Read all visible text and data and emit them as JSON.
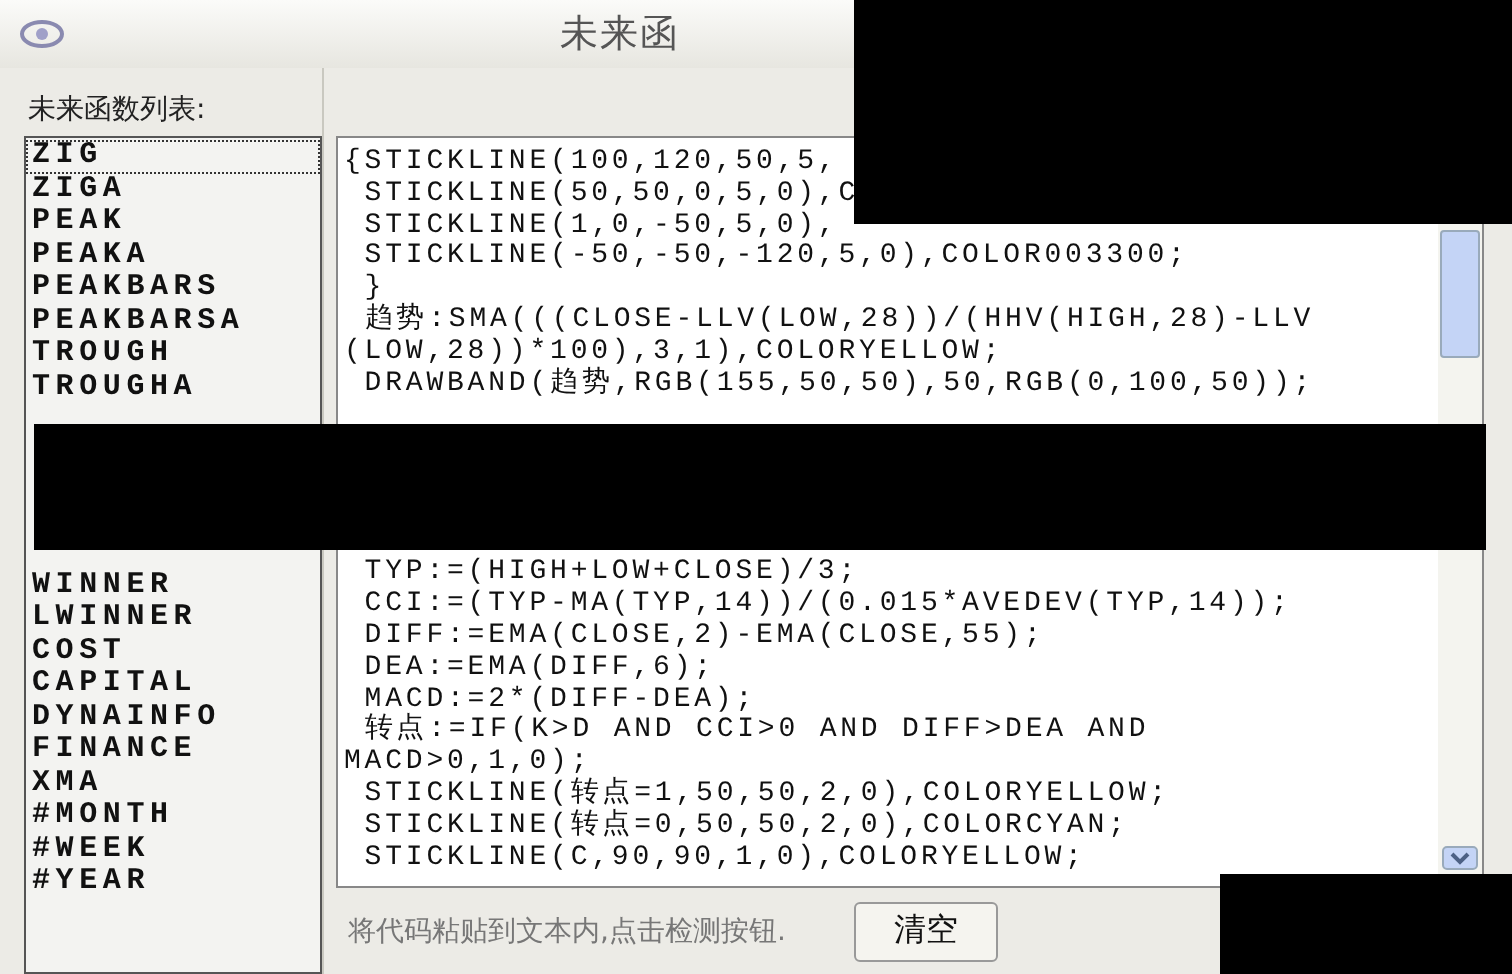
{
  "window": {
    "title": "未来函"
  },
  "function_list": {
    "label": "未来函数列表:",
    "items": [
      {
        "name": "ZIG",
        "selected": true
      },
      {
        "name": "ZIGA",
        "selected": false
      },
      {
        "name": "PEAK",
        "selected": false
      },
      {
        "name": "PEAKA",
        "selected": false
      },
      {
        "name": "PEAKBARS",
        "selected": false
      },
      {
        "name": "PEAKBARSA",
        "selected": false
      },
      {
        "name": "TROUGH",
        "selected": false
      },
      {
        "name": "TROUGHA",
        "selected": false
      }
    ],
    "items_below": [
      {
        "name": "WINNER",
        "selected": false
      },
      {
        "name": "LWINNER",
        "selected": false
      },
      {
        "name": "COST",
        "selected": false
      },
      {
        "name": "CAPITAL",
        "selected": false
      },
      {
        "name": "DYNAINFO",
        "selected": false
      },
      {
        "name": "FINANCE",
        "selected": false
      },
      {
        "name": "XMA",
        "selected": false
      },
      {
        "name": "#MONTH",
        "selected": false
      },
      {
        "name": "#WEEK",
        "selected": false
      },
      {
        "name": "#YEAR",
        "selected": false
      }
    ]
  },
  "code": {
    "lines": [
      "{STICKLINE(100,120,50,5,",
      " STICKLINE(50,50,0,5,0),C",
      " STICKLINE(1,0,-50,5,0),",
      " STICKLINE(-50,-50,-120,5,0),COLOR003300;",
      " }",
      " 趋势:SMA(((CLOSE-LLV(LOW,28))/(HHV(HIGH,28)-LLV",
      "(LOW,28))*100),3,1),COLORYELLOW;",
      " DRAWBAND(趋势,RGB(155,50,50),50,RGB(0,100,50));"
    ],
    "lines_below": [
      " TYP:=(HIGH+LOW+CLOSE)/3;",
      " CCI:=(TYP-MA(TYP,14))/(0.015*AVEDEV(TYP,14));",
      " DIFF:=EMA(CLOSE,2)-EMA(CLOSE,55);",
      " DEA:=EMA(DIFF,6);",
      " MACD:=2*(DIFF-DEA);",
      " 转点:=IF(K>D AND CCI>0 AND DIFF>DEA AND",
      "MACD>0,1,0);",
      " STICKLINE(转点=1,50,50,2,0),COLORYELLOW;",
      " STICKLINE(转点=0,50,50,2,0),COLORCYAN;",
      " STICKLINE(C,90,90,1,0),COLORYELLOW;"
    ]
  },
  "hint": "将代码粘贴到文本内,点击检测按钮.",
  "buttons": [
    "清空"
  ]
}
